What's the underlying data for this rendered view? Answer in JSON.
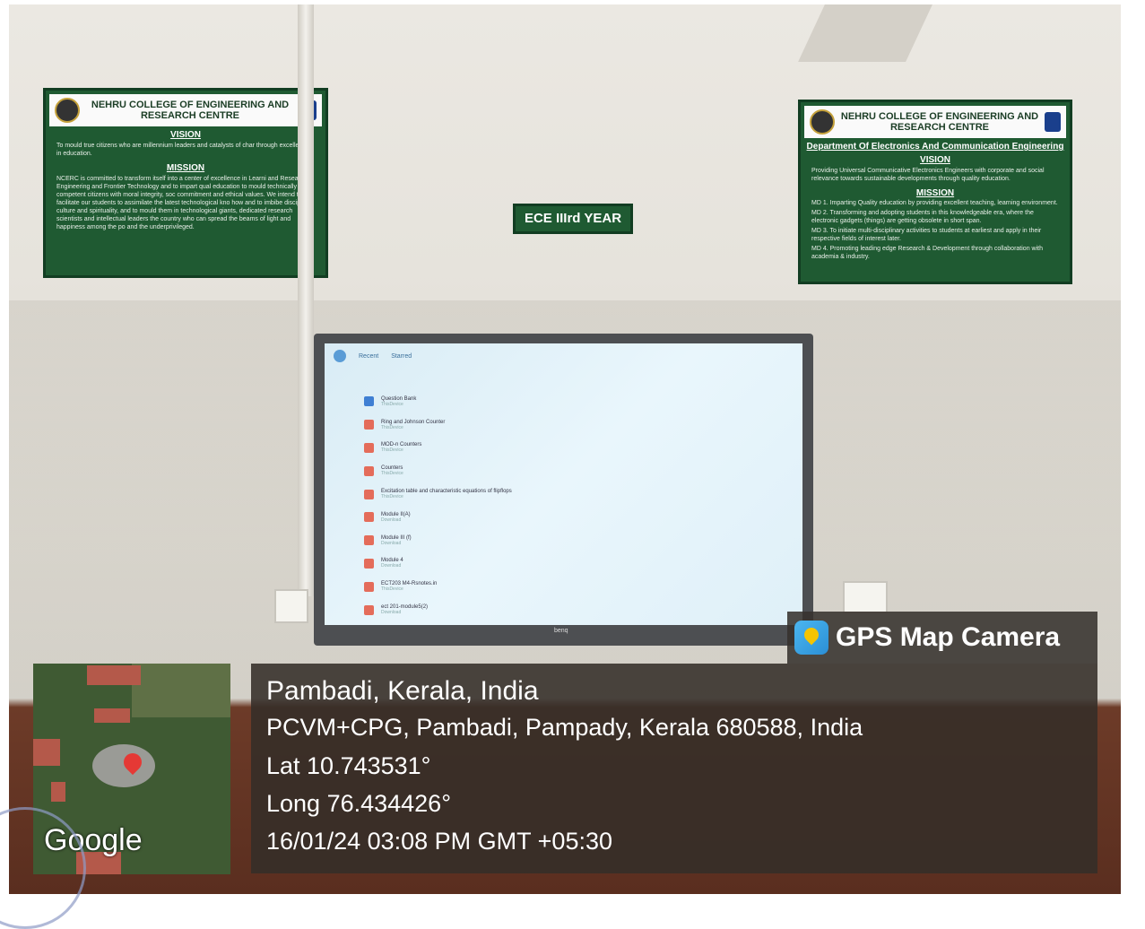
{
  "poster_left": {
    "college": "NEHRU COLLEGE OF ENGINEERING AND RESEARCH CENTRE",
    "vision_heading": "VISION",
    "vision_text": "To mould true citizens who are millennium leaders and catalysts of char through excellence in education.",
    "mission_heading": "MISSION",
    "mission_text": "NCERC is committed to transform itself into a center of excellence in Learni and Research in Engineering and Frontier Technology and to impart qual education to mould technically competent citizens with moral integrity, soc commitment and ethical values. We intend to facilitate our students to assimilate the latest technological kno how and to imbibe discipline, culture and spirituality, and to mould them in technological giants, dedicated research scientists and intellectual leaders the country who can spread the beams of light and happiness among the po and the underprivileged."
  },
  "sign": {
    "text": "ECE IIIrd YEAR"
  },
  "poster_right": {
    "college": "NEHRU COLLEGE OF ENGINEERING AND RESEARCH CENTRE",
    "department": "Department Of Electronics And Communication Engineering",
    "vision_heading": "VISION",
    "vision_text": "Providing Universal Communicative Electronics Engineers with corporate and social relevance towards sustainable developments through quality education.",
    "mission_heading": "MISSION",
    "missions": [
      "MD 1. Imparting Quality education by providing excellent teaching, learning environment.",
      "MD 2. Transforming and adopting students in this knowledgeable era, where the electronic gadgets (things) are getting obsolete in short span.",
      "MD 3. To initiate multi-disciplinary activities to students at earliest and apply in their respective fields of interest later.",
      "MD 4. Promoting leading edge Research & Development through collaboration with academia & industry."
    ]
  },
  "tv": {
    "brand": "benq",
    "tabs": [
      "Recent",
      "Starred"
    ],
    "files": [
      {
        "name": "Question Bank",
        "sub": "ThisDevice",
        "type": "blue"
      },
      {
        "name": "Ring and Johnson Counter",
        "sub": "ThisDevice",
        "type": "red"
      },
      {
        "name": "MOD-n Counters",
        "sub": "ThisDevice",
        "type": "red"
      },
      {
        "name": "Counters",
        "sub": "ThisDevice",
        "type": "red"
      },
      {
        "name": "Excitation table and characteristic equations of flipflops",
        "sub": "ThisDevice",
        "type": "red"
      },
      {
        "name": "Module II(A)",
        "sub": "Download",
        "type": "red"
      },
      {
        "name": "Module III (f)",
        "sub": "Download",
        "type": "red"
      },
      {
        "name": "Module 4",
        "sub": "Download",
        "type": "red"
      },
      {
        "name": "ECT203 M4-Rsnotes.in",
        "sub": "ThisDevice",
        "type": "red"
      },
      {
        "name": "ect 201-module5(2)",
        "sub": "Download",
        "type": "red"
      }
    ]
  },
  "map": {
    "brand": "Google"
  },
  "gps": {
    "app_name": "GPS Map Camera",
    "place": "Pambadi, Kerala, India",
    "address": "PCVM+CPG, Pambadi, Pampady, Kerala 680588, India",
    "lat": "Lat 10.743531°",
    "long": "Long 76.434426°",
    "datetime": "16/01/24 03:08 PM GMT +05:30"
  }
}
